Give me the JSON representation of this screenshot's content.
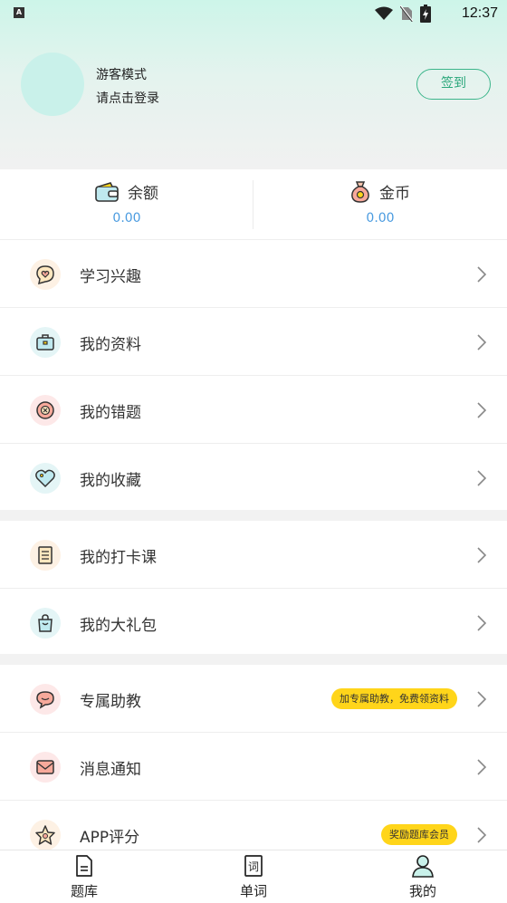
{
  "status_bar": {
    "app_badge": "A",
    "time": "12:37"
  },
  "profile": {
    "title": "游客模式",
    "subtitle": "请点击登录",
    "signin_label": "签到"
  },
  "wallet": {
    "balance": {
      "label": "余额",
      "value": "0.00"
    },
    "coins": {
      "label": "金币",
      "value": "0.00"
    }
  },
  "menu": {
    "group1": [
      {
        "label": "学习兴趣",
        "icon": "chat-heart-icon"
      },
      {
        "label": "我的资料",
        "icon": "briefcase-icon"
      },
      {
        "label": "我的错题",
        "icon": "close-circle-icon"
      },
      {
        "label": "我的收藏",
        "icon": "heart-tag-icon"
      }
    ],
    "group2": [
      {
        "label": "我的打卡课",
        "icon": "checklist-icon"
      },
      {
        "label": "我的大礼包",
        "icon": "gift-bag-icon"
      }
    ],
    "group3": [
      {
        "label": "专属助教",
        "icon": "chat-bubble-icon",
        "badge": "加专属助教，免费领资料"
      },
      {
        "label": "消息通知",
        "icon": "envelope-icon"
      },
      {
        "label": "APP评分",
        "icon": "star-icon",
        "badge": "奖励题库会员"
      }
    ]
  },
  "tabbar": {
    "tabs": [
      {
        "label": "题库",
        "icon": "document-icon"
      },
      {
        "label": "单词",
        "icon": "word-icon"
      },
      {
        "label": "我的",
        "icon": "user-icon"
      }
    ]
  },
  "colors": {
    "accent": "#3bb58a",
    "value_blue": "#4a9be0",
    "badge_yellow": "#ffd51a",
    "header_top": "#cdf5e9",
    "header_bottom": "#f1f1f1"
  }
}
